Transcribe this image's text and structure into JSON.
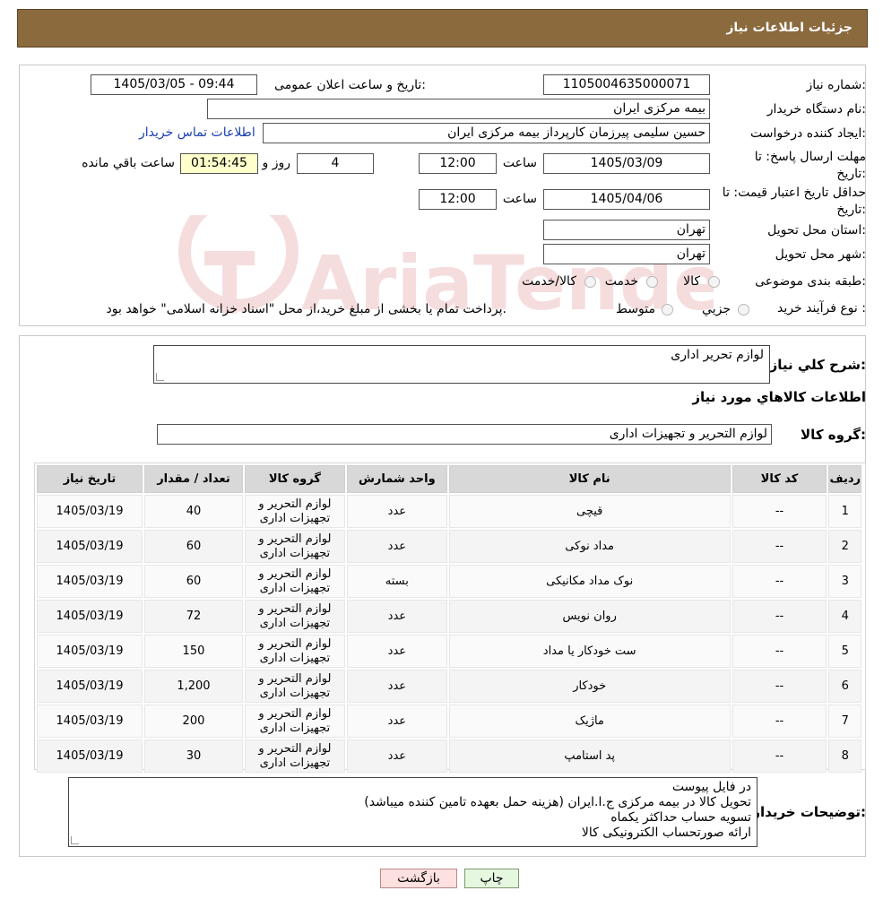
{
  "header": {
    "title": "جزئیات اطلاعات نیاز"
  },
  "info": {
    "need_number": {
      "label": "شماره نیاز:",
      "value": "1105004635000071"
    },
    "announce_datetime": {
      "label": "تاریخ و ساعت اعلان عمومی:",
      "value": "1405/03/05 - 09:44"
    },
    "buyer_org": {
      "label": "نام دستگاه خریدار:",
      "value": "بیمه مرکزی ایران"
    },
    "requester": {
      "label": "ایجاد کننده درخواست:",
      "value": "حسین سلیمی پیرزمان کارپرداز بیمه مرکزی ایران"
    },
    "contact_link": "اطلاعات تماس خریدار",
    "deadline": {
      "label": "مهلت ارسال پاسخ: تا تاریخ:",
      "date": "1405/03/09",
      "time_label": "ساعت",
      "time": "12:00",
      "days": "4",
      "days_label": "روز و",
      "remaining": "01:54:45",
      "remaining_label": "ساعت باقي مانده"
    },
    "validity": {
      "label": "حداقل تاریخ اعتبار قیمت: تا تاریخ:",
      "date": "1405/04/06",
      "time_label": "ساعت",
      "time": "12:00"
    },
    "province": {
      "label": "استان محل تحویل:",
      "value": "تهران"
    },
    "city": {
      "label": "شهر محل تحویل:",
      "value": "تهران"
    },
    "category": {
      "label": "طبقه بندی موضوعی:",
      "options": [
        "کالا",
        "خدمت",
        "کالا/خدمت"
      ]
    },
    "process": {
      "label": "نوع فرآیند خرید :",
      "options": [
        "جزیي",
        "متوسط"
      ],
      "note": "پرداخت تمام یا بخشی از مبلغ خرید،از محل \"اسناد خزانه اسلامی\" خواهد بود."
    }
  },
  "watermark_text": "AriaTender.neT",
  "description": {
    "label": "شرح کلي نياز:",
    "value": "لوازم تحریر اداری"
  },
  "goods_info_title": "اطلاعات کالاهاي مورد نياز",
  "goods_group": {
    "label": "گروه کالا:",
    "value": "لوازم التحریر و تجهیزات اداری"
  },
  "table": {
    "headers": [
      "رديف",
      "کد کالا",
      "نام کالا",
      "واحد شمارش",
      "گروه کالا",
      "تعداد / مقدار",
      "تاریخ نیاز"
    ],
    "rows": [
      {
        "n": "1",
        "code": "--",
        "name": "قیچی",
        "unit": "عدد",
        "group": "لوازم التحریر و تجهیزات اداری",
        "qty": "40",
        "date": "1405/03/19"
      },
      {
        "n": "2",
        "code": "--",
        "name": "مداد نوکی",
        "unit": "عدد",
        "group": "لوازم التحریر و تجهیزات اداری",
        "qty": "60",
        "date": "1405/03/19"
      },
      {
        "n": "3",
        "code": "--",
        "name": "نوک مداد مکانیکی",
        "unit": "بسته",
        "group": "لوازم التحریر و تجهیزات اداری",
        "qty": "60",
        "date": "1405/03/19"
      },
      {
        "n": "4",
        "code": "--",
        "name": "روان نویس",
        "unit": "عدد",
        "group": "لوازم التحریر و تجهیزات اداری",
        "qty": "72",
        "date": "1405/03/19"
      },
      {
        "n": "5",
        "code": "--",
        "name": "ست خودکار یا مداد",
        "unit": "عدد",
        "group": "لوازم التحریر و تجهیزات اداری",
        "qty": "150",
        "date": "1405/03/19"
      },
      {
        "n": "6",
        "code": "--",
        "name": "خودکار",
        "unit": "عدد",
        "group": "لوازم التحریر و تجهیزات اداری",
        "qty": "1,200",
        "date": "1405/03/19"
      },
      {
        "n": "7",
        "code": "--",
        "name": "ماژیک",
        "unit": "عدد",
        "group": "لوازم التحریر و تجهیزات اداری",
        "qty": "200",
        "date": "1405/03/19"
      },
      {
        "n": "8",
        "code": "--",
        "name": "پد استامپ",
        "unit": "عدد",
        "group": "لوازم التحریر و تجهیزات اداری",
        "qty": "30",
        "date": "1405/03/19"
      }
    ]
  },
  "buyer_notes": {
    "label": "توضیحات خریدار:",
    "lines": [
      "در فایل پیوست",
      "تحویل کالا در بیمه مرکزی ج.ا.ایران (هزینه حمل بعهده تامین کننده میباشد)",
      "تسویه حساب حداکثر یکماه",
      "ارائه صورتحساب الکترونیکی کالا"
    ]
  },
  "buttons": {
    "print": "چاپ",
    "back": "بازگشت"
  },
  "colors": {
    "header_bg": "#8b6a3e",
    "back_button_bg": "#fde0e0",
    "print_button_bg": "#e6f7e0"
  }
}
